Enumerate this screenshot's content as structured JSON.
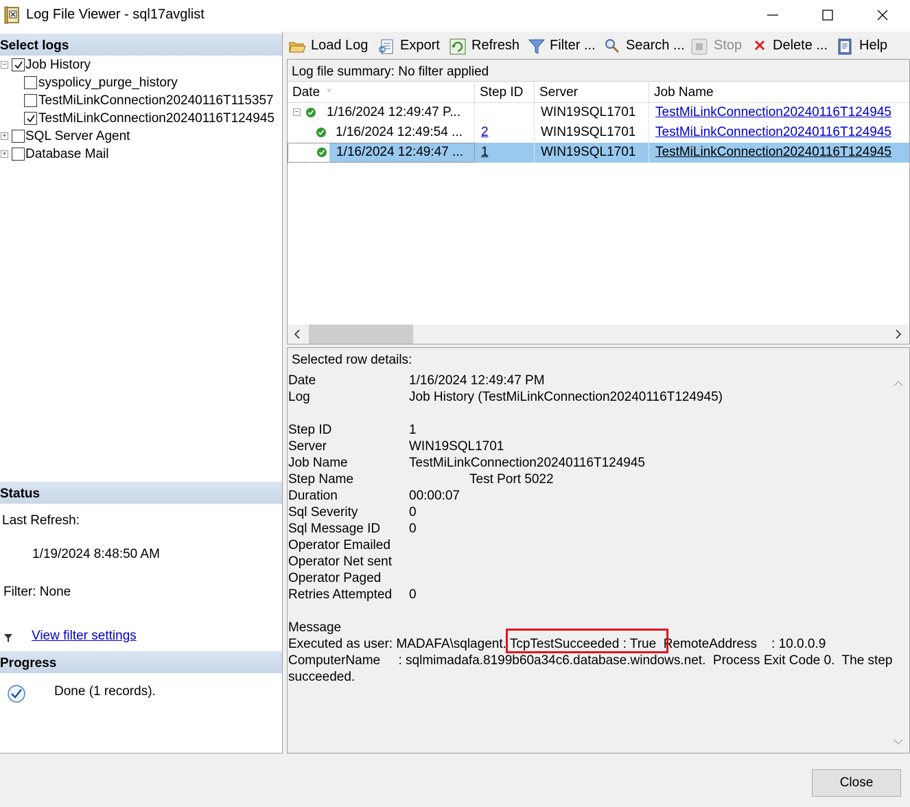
{
  "window": {
    "title": "Log File Viewer - sql17avglist",
    "icon": "log-viewer-icon"
  },
  "left": {
    "select_logs_header": "Select logs",
    "tree": [
      {
        "label": "Job History",
        "checked": true,
        "expander": "−"
      },
      {
        "label": "syspolicy_purge_history",
        "checked": false
      },
      {
        "label": "TestMiLinkConnection20240116T115357",
        "checked": false
      },
      {
        "label": "TestMiLinkConnection20240116T124945",
        "checked": true
      },
      {
        "label": "SQL Server Agent",
        "checked": false,
        "expander": "+"
      },
      {
        "label": "Database Mail",
        "checked": false,
        "expander": "+"
      }
    ],
    "status_header": "Status",
    "last_refresh_label": "Last Refresh:",
    "last_refresh_value": "1/19/2024 8:48:50 AM",
    "filter_text": "Filter: None",
    "view_filter_link": "View filter settings",
    "progress_header": "Progress",
    "progress_text": "Done (1 records)."
  },
  "toolbar": {
    "load_log": "Load Log",
    "export": "Export",
    "refresh": "Refresh",
    "filter": "Filter ...",
    "search": "Search ...",
    "stop": "Stop",
    "delete": "Delete ...",
    "help": "Help"
  },
  "grid": {
    "summary": "Log file summary: No filter applied",
    "columns": [
      "Date",
      "Step ID",
      "Server",
      "Job Name"
    ],
    "rows": [
      {
        "expander": "−",
        "date": "1/16/2024 12:49:47 P...",
        "step_id": "",
        "server": "WIN19SQL1701",
        "job_name": "TestMiLinkConnection20240116T124945",
        "selected": false
      },
      {
        "date": "1/16/2024 12:49:54 ...",
        "step_id": "2",
        "server": "WIN19SQL1701",
        "job_name": "TestMiLinkConnection20240116T124945",
        "selected": false
      },
      {
        "date": "1/16/2024 12:49:47 ...",
        "step_id": "1",
        "server": "WIN19SQL1701",
        "job_name": "TestMiLinkConnection20240116T124945",
        "selected": true
      }
    ]
  },
  "details": {
    "header": "Selected row details:",
    "fields": [
      {
        "label": "Date",
        "value": "1/16/2024 12:49:47 PM"
      },
      {
        "label": "Log",
        "value": "Job History (TestMiLinkConnection20240116T124945)"
      },
      {
        "label": "",
        "value": ""
      },
      {
        "label": "Step ID",
        "value": "1"
      },
      {
        "label": "Server",
        "value": "WIN19SQL1701"
      },
      {
        "label": "Job Name",
        "value": "TestMiLinkConnection20240116T124945"
      },
      {
        "label": "Step Name",
        "value": "Test Port 5022"
      },
      {
        "label": "Duration",
        "value": "00:00:07"
      },
      {
        "label": "Sql Severity",
        "value": "0"
      },
      {
        "label": "Sql Message ID",
        "value": "0"
      },
      {
        "label": "Operator Emailed",
        "value": ""
      },
      {
        "label": "Operator Net sent",
        "value": ""
      },
      {
        "label": "Operator Paged",
        "value": ""
      },
      {
        "label": "Retries Attempted",
        "value": "0"
      }
    ],
    "message_label": "Message",
    "message_lines": [
      "Executed as user: MADAFA\\sqlagent. TcpTestSucceeded : True  RemoteAddress    : 10.0.0.9",
      "ComputerName     : sqlmimadafa.8199b60a34c6.database.windows.net.  Process Exit Code 0.  The step",
      "succeeded."
    ]
  },
  "footer": {
    "close": "Close"
  },
  "colors": {
    "selection": "#99c9ef",
    "link": "#0000cc",
    "highlight_box": "#e0141e",
    "header_gradient": "#c8d6e8"
  }
}
